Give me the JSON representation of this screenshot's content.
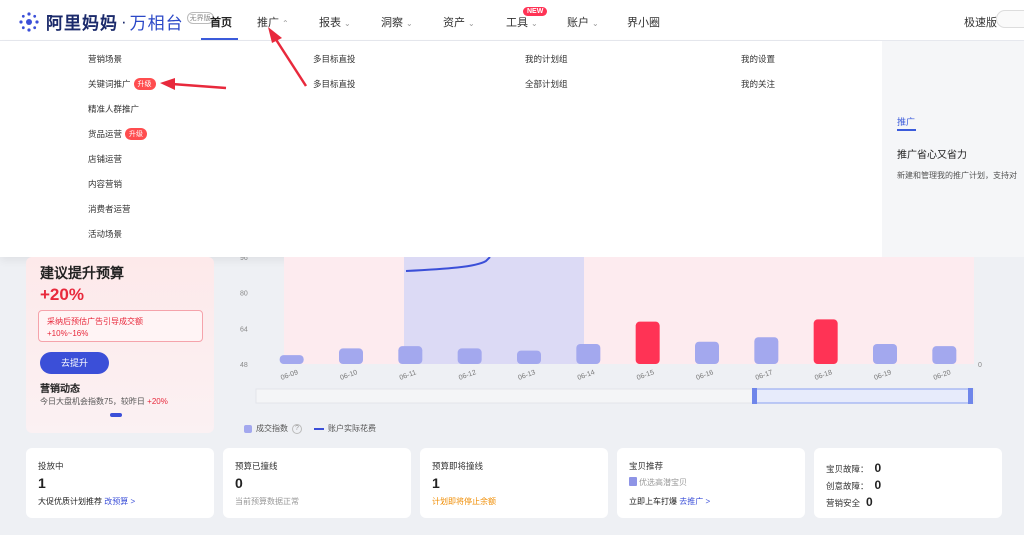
{
  "header": {
    "logo_main": "阿里妈妈",
    "logo_sep": "·",
    "logo_sub": "万相台",
    "logo_version": "无界版",
    "nav": [
      {
        "label": "首页",
        "chevron": ""
      },
      {
        "label": "推广",
        "chevron": "^"
      },
      {
        "label": "报表",
        "chevron": "v"
      },
      {
        "label": "洞察",
        "chevron": "v"
      },
      {
        "label": "资产",
        "chevron": "v"
      },
      {
        "label": "工具",
        "chevron": "v"
      },
      {
        "label": "账户",
        "chevron": "v"
      },
      {
        "label": "界小圈",
        "chevron": ""
      }
    ],
    "new_badge": "NEW",
    "speed_label": "极速版"
  },
  "dropdown": {
    "col1": [
      "营销场景",
      "关键词推广",
      "精准人群推广",
      "货品运营",
      "店铺运营",
      "内容营销",
      "消费者运营",
      "活动场景"
    ],
    "upgrade_badge": "升级",
    "col2": [
      "多目标直投",
      "多目标直投"
    ],
    "col3": [
      "我的计划组",
      "全部计划组"
    ],
    "col4": [
      "我的设置",
      "我的关注"
    ],
    "right_panel": {
      "tab": "推广",
      "title": "推广省心又省力",
      "desc": "新建和管理我的推广计划，支持对"
    }
  },
  "budget_card": {
    "title": "建议提升预算",
    "percent": "+20%",
    "box_text": "采纳后预估广告引导成交额",
    "box_value": "+10%~16%",
    "button": "去提升",
    "dynamics_title": "营销动态",
    "dynamics_text": "今日大盘机会指数75，较昨日",
    "dynamics_change": "+20%"
  },
  "chart_data": {
    "type": "bar",
    "categories": [
      "06-09",
      "06-10",
      "06-11",
      "06-12",
      "06-13",
      "06-14",
      "06-15",
      "06-16",
      "06-17",
      "06-18",
      "06-19",
      "06-20"
    ],
    "series": [
      {
        "name": "成交指数",
        "values": [
          52,
          55,
          56,
          55,
          54,
          57,
          67,
          58,
          60,
          68,
          57,
          56
        ]
      },
      {
        "name": "账户实际花费",
        "values": []
      }
    ],
    "highlight_indices": [
      6,
      9
    ],
    "y_ticks": [
      "96",
      "80",
      "64",
      "48"
    ],
    "ylim": [
      48,
      96
    ],
    "y2_tick": "0",
    "bar_color": "#a3a8ee",
    "highlight_color": "#ff3355",
    "line_color": "#3b4fd8"
  },
  "legend": {
    "bars": "成交指数",
    "line": "账户实际花费",
    "help": "?"
  },
  "stats": [
    {
      "label": "投放中",
      "value": "1",
      "foot": "大促优质计划推荐",
      "link": "改预算 >"
    },
    {
      "label": "预算已撞线",
      "value": "0",
      "foot": "当前预算数据正常"
    },
    {
      "label": "预算即将撞线",
      "value": "1",
      "foot": "计划即将停止余额"
    },
    {
      "label": "宝贝推荐",
      "sub": "优选高潜宝贝",
      "foot": "立即上车打爆",
      "link": "去推广 >"
    }
  ],
  "health": [
    {
      "label": "宝贝故障：",
      "value": "0"
    },
    {
      "label": "创意故障：",
      "value": "0"
    },
    {
      "label": "营销安全",
      "value": "0"
    }
  ]
}
